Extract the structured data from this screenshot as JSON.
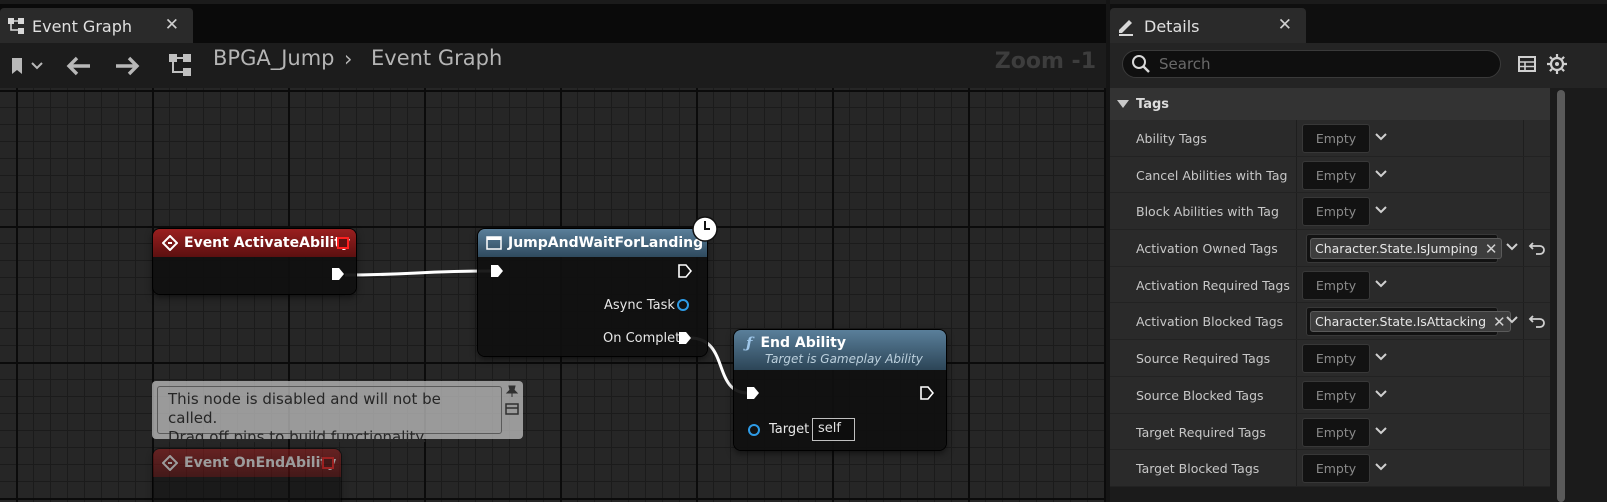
{
  "graph_tab": {
    "title": "Event Graph",
    "close": "✕"
  },
  "toolbar": {
    "breadcrumb_root": "BPGA_Jump",
    "breadcrumb_separator": "›",
    "breadcrumb_current": "Event Graph",
    "zoom": "Zoom -1"
  },
  "nodes": {
    "activate": {
      "title": "Event ActivateAbility"
    },
    "jump": {
      "title": "JumpAndWaitForLanding",
      "pin_async": "Async Task",
      "pin_complete": "On Complete"
    },
    "end": {
      "title": "End Ability",
      "subtitle": "Target is Gameplay Ability",
      "pin_target": "Target",
      "target_value": "self"
    },
    "disabled": {
      "title": "Event OnEndAbility"
    }
  },
  "disabled_comment": {
    "line1": "This node is disabled and will not be called.",
    "line2": "Drag off pins to build functionality."
  },
  "details": {
    "tab_title": "Details",
    "close": "✕",
    "search_placeholder": "Search",
    "section": "Tags",
    "rows": [
      {
        "label": "Ability Tags",
        "value": "Empty"
      },
      {
        "label": "Cancel Abilities with Tag",
        "value": "Empty"
      },
      {
        "label": "Block Abilities with Tag",
        "value": "Empty"
      },
      {
        "label": "Activation Owned Tags",
        "tag": "Character.State.IsJumping",
        "remove": "✕"
      },
      {
        "label": "Activation Required Tags",
        "value": "Empty"
      },
      {
        "label": "Activation Blocked Tags",
        "tag": "Character.State.IsAttacking",
        "remove": "✕"
      },
      {
        "label": "Source Required Tags",
        "value": "Empty"
      },
      {
        "label": "Source Blocked Tags",
        "value": "Empty"
      },
      {
        "label": "Target Required Tags",
        "value": "Empty"
      },
      {
        "label": "Target Blocked Tags",
        "value": "Empty"
      }
    ]
  },
  "colors": {
    "event_header": "#9a1f1f",
    "function_header": "#5a7f9a",
    "exec_wire": "#ffffff",
    "object_pin": "#2e9be6",
    "accent_close": "#e02020"
  },
  "icons": {
    "graph_tab": "graph-icon",
    "bookmark": "bookmark-icon",
    "back": "arrow-left-icon",
    "forward": "arrow-right-icon",
    "blueprint": "graph-icon",
    "details": "pencil-icon",
    "search": "search-icon",
    "table": "table-icon",
    "settings": "gear-icon",
    "clock": "clock-icon",
    "function": "function-icon"
  }
}
